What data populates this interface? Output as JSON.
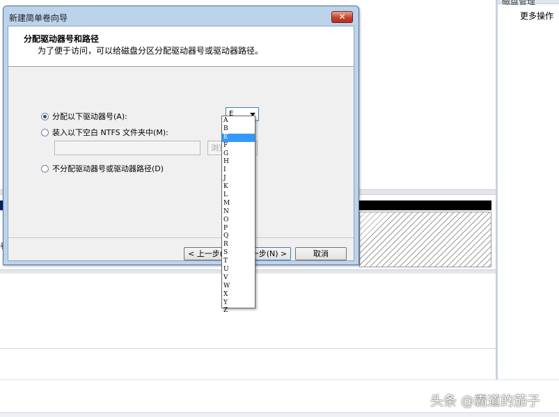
{
  "background": {
    "right_panel_title": "磁盘管理",
    "more_actions": "更多操作",
    "left_stub": "卷"
  },
  "dialog": {
    "title": "新建简单卷向导",
    "close_label": "✕",
    "header_title": "分配驱动器号和路径",
    "header_subtitle": "为了便于访问，可以给磁盘分区分配驱动器号或驱动器路径。",
    "option_assign_letter": "分配以下驱动器号(A):",
    "option_mount_folder": "装入以下空白 NTFS 文件夹中(M):",
    "option_no_assign": "不分配驱动器号或驱动器路径(D)",
    "folder_path_value": "",
    "browse_label": "浏览(R)...",
    "selected_drive": "E",
    "back_label": "< 上一步(B)",
    "next_label": "下一步(N) >",
    "cancel_label": "取消"
  },
  "dropdown": {
    "selected": "E",
    "items": [
      "A",
      "B",
      "E",
      "F",
      "G",
      "H",
      "I",
      "J",
      "K",
      "L",
      "M",
      "N",
      "O",
      "P",
      "Q",
      "R",
      "S",
      "T",
      "U",
      "V",
      "W",
      "X",
      "Y",
      "Z"
    ]
  },
  "watermark": "头条 @霸道的茄子"
}
